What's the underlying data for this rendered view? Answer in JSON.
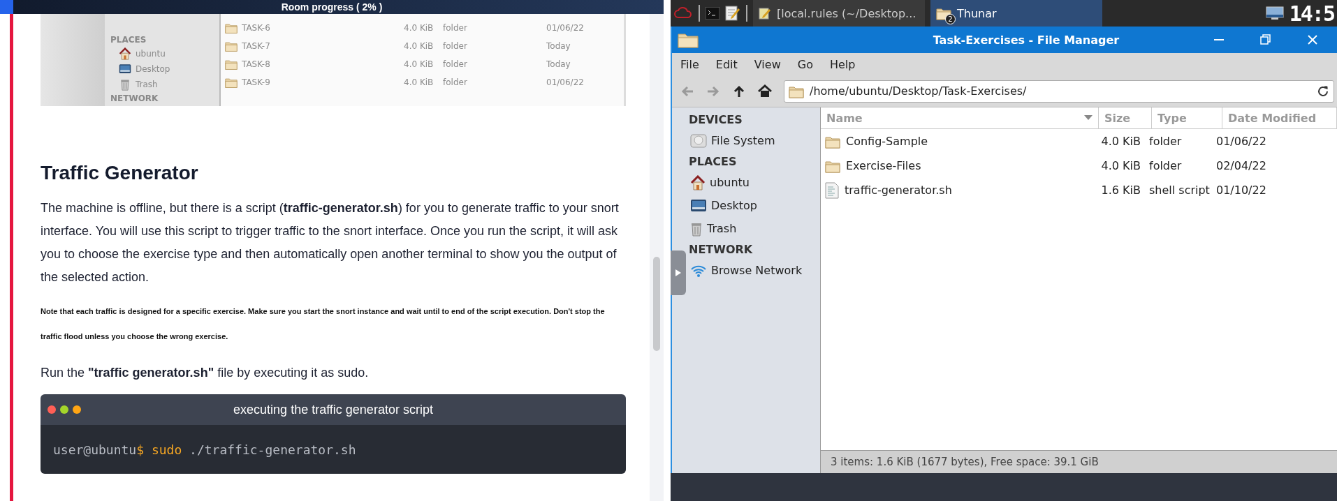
{
  "room_progress": {
    "label": "Room progress ( 2% )",
    "level": 0.02
  },
  "article": {
    "screenshot": {
      "sidebar": [
        {
          "kind": "heading",
          "label": "PLACES"
        },
        {
          "kind": "home",
          "label": "ubuntu"
        },
        {
          "kind": "desktop",
          "label": "Desktop"
        },
        {
          "kind": "trash",
          "label": "Trash"
        },
        {
          "kind": "heading",
          "label": "NETWORK"
        }
      ],
      "files": [
        {
          "name": "TASK-6",
          "size": "4.0 KiB",
          "type": "folder",
          "modified": "01/06/22"
        },
        {
          "name": "TASK-7",
          "size": "4.0 KiB",
          "type": "folder",
          "modified": "Today"
        },
        {
          "name": "TASK-8",
          "size": "4.0 KiB",
          "type": "folder",
          "modified": "Today"
        },
        {
          "name": "TASK-9",
          "size": "4.0 KiB",
          "type": "folder",
          "modified": "01/06/22"
        }
      ]
    },
    "heading": "Traffic Generator",
    "paragraph": "The machine is offline, but there is a script (**traffic-generator.sh**) for you to generate traffic to your snort interface. You will use this script to trigger traffic to the snort interface. Once you run the script, it will ask you to choose the exercise type and then automatically open another terminal to show you the output of the selected action.",
    "note": "Note that each traffic is designed for a specific exercise. Make sure you start the snort instance and wait until to end of the script execution. Don't stop the traffic flood unless you choose the wrong exercise.",
    "instruction": "Run the **\"traffic generator.sh\"** file by executing it as sudo.",
    "code_block": {
      "title": "executing the traffic generator script",
      "prompt": "user@ubuntu",
      "prompt_sign": "$",
      "command": "sudo",
      "argument": "./traffic-generator.sh"
    }
  },
  "taskbar": {
    "tasks": [
      {
        "label": "[local.rules (~/Desktop...",
        "kind": "editor",
        "selected": false
      },
      {
        "label": "Thunar",
        "kind": "folder",
        "selected": true,
        "badge": "2"
      }
    ],
    "clock": "14:5"
  },
  "file_manager": {
    "title": "Task-Exercises - File Manager",
    "menu": [
      "File",
      "Edit",
      "View",
      "Go",
      "Help"
    ],
    "toolbar": [
      {
        "kind": "back",
        "disabled": true
      },
      {
        "kind": "forward",
        "disabled": true
      },
      {
        "kind": "up",
        "disabled": false
      },
      {
        "kind": "home",
        "disabled": false
      }
    ],
    "location": "/home/ubuntu/Desktop/Task-Exercises/",
    "sidebar": [
      {
        "kind": "heading",
        "label": "DEVICES"
      },
      {
        "kind": "drive",
        "label": "File System"
      },
      {
        "kind": "heading",
        "label": "PLACES"
      },
      {
        "kind": "home",
        "label": "ubuntu"
      },
      {
        "kind": "desktop",
        "label": "Desktop"
      },
      {
        "kind": "trash",
        "label": "Trash"
      },
      {
        "kind": "heading",
        "label": "NETWORK"
      },
      {
        "kind": "network",
        "label": "Browse Network"
      }
    ],
    "columns": [
      "Name",
      "Size",
      "Type",
      "Date Modified"
    ],
    "files": [
      {
        "kind": "folder",
        "name": "Config-Sample",
        "size": "4.0 KiB",
        "type": "folder",
        "modified": "01/06/22"
      },
      {
        "kind": "folder",
        "name": "Exercise-Files",
        "size": "4.0 KiB",
        "type": "folder",
        "modified": "02/04/22"
      },
      {
        "kind": "script",
        "name": "traffic-generator.sh",
        "size": "1.6 KiB",
        "type": "shell script",
        "modified": "01/10/22"
      }
    ],
    "status": "3 items: 1.6 KiB (1677 bytes), Free space: 39.1 GiB"
  }
}
